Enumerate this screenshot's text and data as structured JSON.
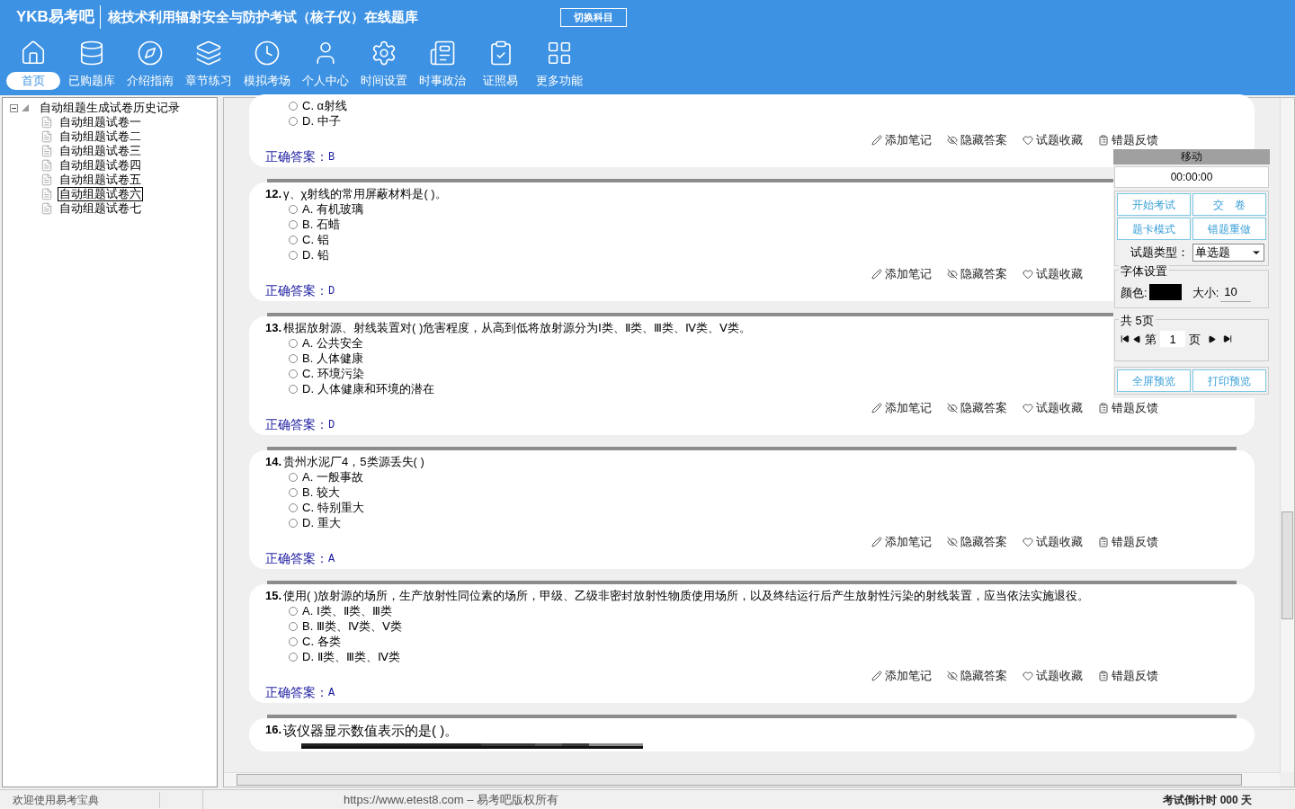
{
  "header": {
    "logo": "YKB易考吧",
    "title": "核技术利用辐射安全与防护考试（核子仪）在线题库",
    "switch_button": "切换科目"
  },
  "toolbar": [
    {
      "label": "首页",
      "selected": true
    },
    {
      "label": "已购题库",
      "selected": false
    },
    {
      "label": "介绍指南",
      "selected": false
    },
    {
      "label": "章节练习",
      "selected": false
    },
    {
      "label": "模拟考场",
      "selected": false
    },
    {
      "label": "个人中心",
      "selected": false
    },
    {
      "label": "时间设置",
      "selected": false
    },
    {
      "label": "时事政治",
      "selected": false
    },
    {
      "label": "证照易",
      "selected": false
    },
    {
      "label": "更多功能",
      "selected": false
    }
  ],
  "tree": {
    "label": "自动组题生成试卷历史记录",
    "expanded": true,
    "children": [
      {
        "label": "自动组题试卷一",
        "selected": false
      },
      {
        "label": "自动组题试卷二",
        "selected": false
      },
      {
        "label": "自动组题试卷三",
        "selected": false
      },
      {
        "label": "自动组题试卷四",
        "selected": false
      },
      {
        "label": "自动组题试卷五",
        "selected": false
      },
      {
        "label": "自动组题试卷六",
        "selected": true
      },
      {
        "label": "自动组题试卷七",
        "selected": false
      }
    ]
  },
  "questions": [
    {
      "options": [
        {
          "text": "C. α射线",
          "selected": false
        },
        {
          "text": "D. 中子",
          "selected": false
        }
      ],
      "actions": [
        "添加笔记",
        "隐藏答案",
        "试题收藏",
        "错题反馈"
      ],
      "answer_label": "正确答案：",
      "answer": "B"
    },
    {
      "number": "12.",
      "text": "γ、χ射线的常用屏蔽材料是( )。",
      "options": [
        {
          "text": "A. 有机玻璃",
          "selected": false
        },
        {
          "text": "B. 石蜡",
          "selected": false
        },
        {
          "text": "C. 铝",
          "selected": false
        },
        {
          "text": "D. 铅",
          "selected": false
        }
      ],
      "actions": [
        "添加笔记",
        "隐藏答案",
        "试题收藏"
      ],
      "answer_label": "正确答案：",
      "answer": "D"
    },
    {
      "number": "13.",
      "text": "根据放射源、射线装置对( )危害程度，从高到低将放射源分为Ⅰ类、Ⅱ类、Ⅲ类、Ⅳ类、Ⅴ类。",
      "options": [
        {
          "text": "A. 公共安全",
          "selected": false
        },
        {
          "text": "B. 人体健康",
          "selected": false
        },
        {
          "text": "C. 环境污染",
          "selected": false
        },
        {
          "text": "D. 人体健康和环境的潜在",
          "selected": false
        }
      ],
      "actions": [
        "添加笔记",
        "隐藏答案",
        "试题收藏",
        "错题反馈"
      ],
      "answer_label": "正确答案：",
      "answer": "D"
    },
    {
      "number": "14.",
      "text": "贵州水泥厂4，5类源丢失( )",
      "options": [
        {
          "text": "A. 一般事故",
          "selected": false
        },
        {
          "text": "B. 较大",
          "selected": false
        },
        {
          "text": "C. 特别重大",
          "selected": false
        },
        {
          "text": "D. 重大",
          "selected": false
        }
      ],
      "actions": [
        "添加笔记",
        "隐藏答案",
        "试题收藏",
        "错题反馈"
      ],
      "answer_label": "正确答案：",
      "answer": "A"
    },
    {
      "number": "15.",
      "text": "使用( )放射源的场所，生产放射性同位素的场所，甲级、乙级非密封放射性物质使用场所，以及终结运行后产生放射性污染的射线装置，应当依法实施退役。",
      "options": [
        {
          "text": "A. Ⅰ类、Ⅱ类、Ⅲ类",
          "selected": false
        },
        {
          "text": "B. Ⅲ类、Ⅳ类、Ⅴ类",
          "selected": false
        },
        {
          "text": "C. 各类",
          "selected": false
        },
        {
          "text": "D. Ⅱ类、Ⅲ类、Ⅳ类",
          "selected": false
        }
      ],
      "actions": [
        "添加笔记",
        "隐藏答案",
        "试题收藏",
        "错题反馈"
      ],
      "answer_label": "正确答案：",
      "answer": "A"
    },
    {
      "number": "16.",
      "text": "该仪器显示数值表示的是(   )。"
    }
  ],
  "panel": {
    "title": "移动",
    "timer": "00:00:00",
    "buttons": [
      "开始考试",
      "交　卷",
      "题卡模式",
      "错题重做"
    ],
    "type_label": "试题类型：",
    "type_value": "单选题",
    "font_legend": "字体设置",
    "color_label": "颜色:",
    "color": "#000000",
    "size_label": "大小:",
    "size_value": "10",
    "pages_legend": "共 5页",
    "page_prefix": "第",
    "page_value": "1",
    "page_suffix": "页",
    "bottom_buttons": [
      "全屏预览",
      "打印预览"
    ]
  },
  "status_bar": {
    "welcome": "欢迎使用易考宝典",
    "copyright": "https://www.etest8.com – 易考吧版权所有",
    "countdown": "考试倒计时 000 天"
  }
}
